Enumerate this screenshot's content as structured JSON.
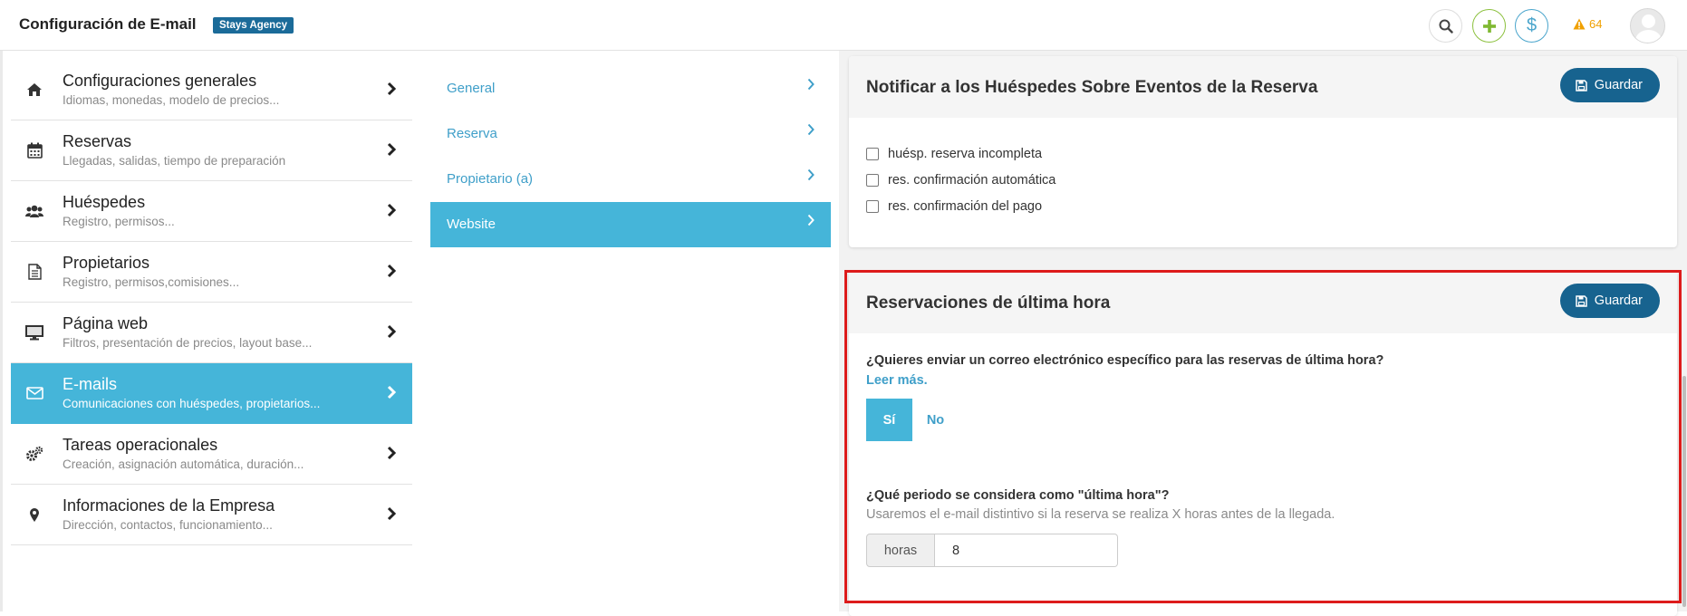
{
  "header": {
    "title": "Configuración de E-mail",
    "badge": "Stays Agency",
    "alerts_count": "64"
  },
  "menu": {
    "items": [
      {
        "title": "Configuraciones generales",
        "subtitle": "Idiomas, monedas, modelo de precios...",
        "icon": "home-icon"
      },
      {
        "title": "Reservas",
        "subtitle": "Llegadas, salidas, tiempo de preparación",
        "icon": "calendar-icon"
      },
      {
        "title": "Huéspedes",
        "subtitle": "Registro, permisos...",
        "icon": "users-icon"
      },
      {
        "title": "Propietarios",
        "subtitle": "Registro, permisos,comisiones...",
        "icon": "document-icon"
      },
      {
        "title": "Página web",
        "subtitle": "Filtros, presentación de precios, layout base...",
        "icon": "monitor-icon"
      },
      {
        "title": "E-mails",
        "subtitle": "Comunicaciones con huéspedes, propietarios...",
        "icon": "envelope-icon"
      },
      {
        "title": "Tareas operacionales",
        "subtitle": "Creación, asignación automática, duración...",
        "icon": "gears-icon"
      },
      {
        "title": "Informaciones de la Empresa",
        "subtitle": "Dirección, contactos, funcionamiento...",
        "icon": "map-pin-icon"
      }
    ]
  },
  "submenu": {
    "items": [
      {
        "label": "General"
      },
      {
        "label": "Reserva"
      },
      {
        "label": "Propietario (a)"
      },
      {
        "label": "Website"
      }
    ]
  },
  "panel1": {
    "title": "Notificar a los Huéspedes Sobre Eventos de la Reserva",
    "save_label": "Guardar",
    "checkboxes": [
      {
        "label": "huésp. reserva incompleta"
      },
      {
        "label": "res. confirmación automática"
      },
      {
        "label": "res. confirmación del pago"
      }
    ]
  },
  "panel2": {
    "title": "Reservaciones de última hora",
    "save_label": "Guardar",
    "question1": "¿Quieres enviar un correo electrónico específico para las reservas de última hora?",
    "read_more": "Leer más.",
    "yes_label": "Sí",
    "no_label": "No",
    "question2": "¿Qué periodo se considera como \"última hora\"?",
    "question2_help": "Usaremos el e-mail distintivo si la reserva se realiza X horas antes de la llegada.",
    "hours_addon": "horas",
    "hours_value": "8"
  },
  "colors": {
    "accent": "#45b5d9",
    "primary_button": "#17638f",
    "highlight": "#dd1b1b"
  }
}
